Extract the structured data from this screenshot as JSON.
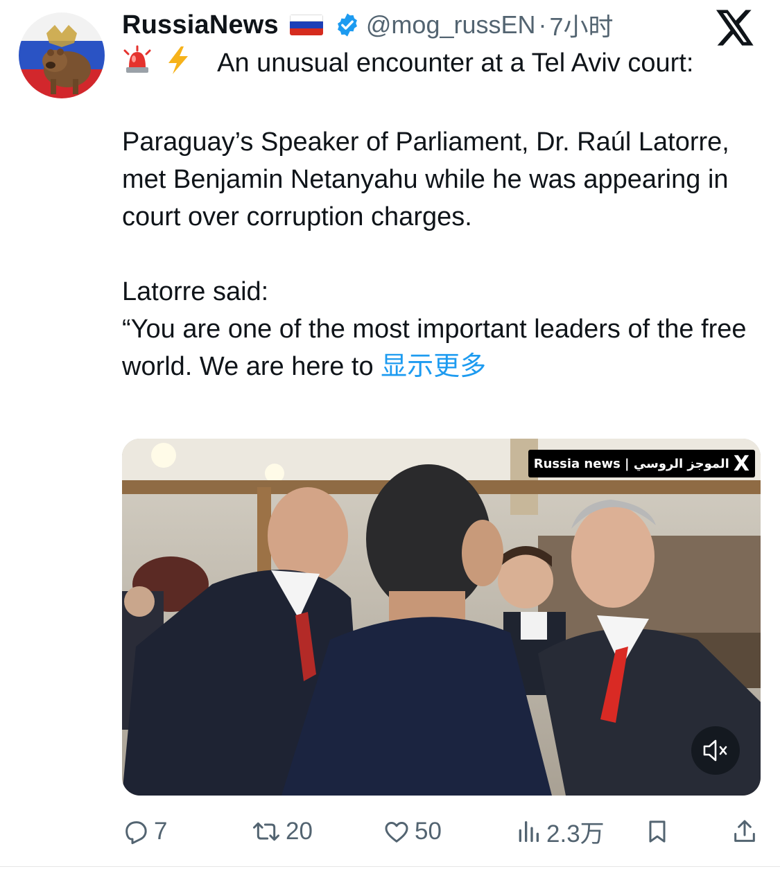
{
  "author": {
    "display_name": "RussiaNews",
    "handle": "@mog_russEN",
    "separator": "·",
    "time": "7小时",
    "avatar_icon": "bear-eagle-avatar",
    "verified_icon": "verified-badge-icon",
    "flag_icon": "russia-flag-icon"
  },
  "tweet": {
    "lead_emoji": "🚨 ⚡",
    "line1": "An unusual encounter at a Tel Aviv court:",
    "para2": "Paraguay’s Speaker of Parliament, Dr. Raúl Latorre, met Benjamin Netanyahu while he was appearing in court over corruption charges.",
    "para3_line1": "Latorre said:",
    "para3_line2": "“You are one of the most important leaders of the free world. We are here to",
    "show_more": "显示更多"
  },
  "media": {
    "watermark_text": "Russia news | الموجز الروسي",
    "watermark_logo": "X",
    "mute_icon": "speaker-muted-icon"
  },
  "actions": {
    "replies": "7",
    "reposts": "20",
    "likes": "50",
    "views": "2.3万"
  },
  "colors": {
    "link": "#1d9bf0",
    "secondary_text": "#536471",
    "verified": "#1d9bf0"
  }
}
